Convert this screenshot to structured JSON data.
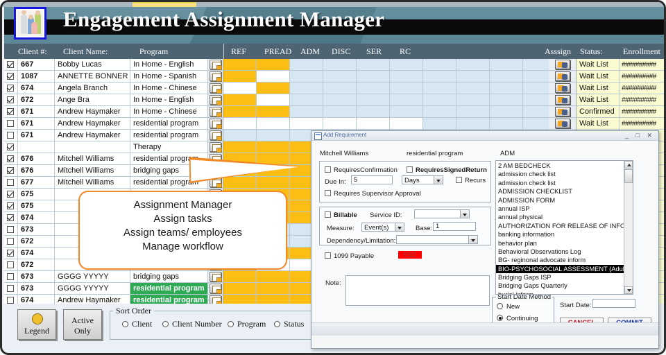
{
  "app": {
    "title": "Engagement Assignment Manager",
    "logo_alt": "people-logo"
  },
  "grid": {
    "headers_left": [
      "Client #:",
      "Client Name:",
      "Program"
    ],
    "headers_mid": [
      "REF",
      "PREAD",
      "ADM",
      "DISC",
      "SER",
      "RC"
    ],
    "assign_header": "Asssign",
    "headers_right": [
      "Status:",
      "Enrollment"
    ],
    "enrollment_mask": "##########",
    "rows": [
      {
        "checked": true,
        "num": "667",
        "name": "Bobby Lucas",
        "program": "In Home - English",
        "cells": [
          "y",
          "y",
          "b",
          "b",
          "b",
          "b",
          "b",
          "b",
          "b",
          "b",
          "b"
        ],
        "status": "Wait List",
        "green": false
      },
      {
        "checked": true,
        "num": "1087",
        "name": "ANNETTE BONNER",
        "program": "In Home - Spanish",
        "cells": [
          "y",
          "w",
          "b",
          "b",
          "b",
          "b",
          "b",
          "b",
          "b",
          "b",
          "b"
        ],
        "status": "Wait List",
        "green": false
      },
      {
        "checked": true,
        "num": "674",
        "name": "Angela Branch",
        "program": "In Home - Chinese",
        "cells": [
          "w",
          "y",
          "b",
          "b",
          "b",
          "b",
          "b",
          "b",
          "b",
          "b",
          "b"
        ],
        "status": "Wait List",
        "green": false
      },
      {
        "checked": true,
        "num": "672",
        "name": "Ange Bra",
        "program": "In Home - English",
        "cells": [
          "y",
          "w",
          "b",
          "b",
          "b",
          "b",
          "b",
          "b",
          "b",
          "b",
          "b"
        ],
        "status": "Wait List",
        "green": false
      },
      {
        "checked": true,
        "num": "671",
        "name": "Andrew Haymaker",
        "program": "In Home - Chinese",
        "cells": [
          "y",
          "y",
          "b",
          "b",
          "b",
          "b",
          "b",
          "b",
          "b",
          "b",
          "b"
        ],
        "status": "Confirmed",
        "green": false
      },
      {
        "checked": false,
        "num": "671",
        "name": "Andrew Haymaker",
        "program": "residential program",
        "cells": [
          "w",
          "w",
          "w",
          "w",
          "w",
          "w",
          "b",
          "b",
          "b",
          "b",
          "b"
        ],
        "status": "Wait List",
        "green": false
      },
      {
        "checked": false,
        "num": "671",
        "name": "Andrew Haymaker",
        "program": "residential program",
        "cells": [
          "b",
          "b",
          "b",
          "b",
          "b",
          "b",
          "b",
          "b",
          "b",
          "b",
          "b"
        ],
        "status": "",
        "green": false
      },
      {
        "checked": true,
        "num": "",
        "name": "",
        "program": "Therapy",
        "cells": [
          "y",
          "y",
          "y",
          "y",
          "y",
          "y",
          "y",
          "y",
          "y",
          "y",
          "y"
        ],
        "status": "",
        "green": false
      },
      {
        "checked": true,
        "num": "676",
        "name": "Mitchell Williams",
        "program": "residential program",
        "cells": [
          "y",
          "y",
          "y",
          "y",
          "y",
          "y",
          "y",
          "y",
          "y",
          "y",
          "y"
        ],
        "status": "",
        "green": false
      },
      {
        "checked": true,
        "num": "676",
        "name": "Mitchell Williams",
        "program": "bridging gaps",
        "cells": [
          "y",
          "y",
          "y",
          "y",
          "y",
          "y",
          "y",
          "y",
          "y",
          "y",
          "y"
        ],
        "status": "",
        "green": false
      },
      {
        "checked": false,
        "num": "677",
        "name": "Mitchell Williams",
        "program": "residential program",
        "cells": [
          "y",
          "y",
          "y",
          "y",
          "y",
          "y",
          "y",
          "y",
          "y",
          "y",
          "y"
        ],
        "status": "",
        "green": false
      },
      {
        "checked": true,
        "num": "675",
        "name": "",
        "program": "",
        "cells": [
          "y",
          "y",
          "y",
          "y",
          "y",
          "y",
          "y",
          "y",
          "y",
          "y",
          "y"
        ],
        "status": "",
        "green": false
      },
      {
        "checked": true,
        "num": "675",
        "name": "",
        "program": "",
        "cells": [
          "y",
          "y",
          "y",
          "y",
          "y",
          "y",
          "y",
          "y",
          "y",
          "y",
          "y"
        ],
        "status": "",
        "green": false
      },
      {
        "checked": true,
        "num": "674",
        "name": "",
        "program": "",
        "cells": [
          "y",
          "y",
          "y",
          "y",
          "y",
          "y",
          "y",
          "y",
          "y",
          "y",
          "y"
        ],
        "status": "",
        "green": false
      },
      {
        "checked": false,
        "num": "673",
        "name": "",
        "program": "",
        "cells": [
          "w",
          "b",
          "b",
          "b",
          "b",
          "b",
          "b",
          "b",
          "b",
          "b",
          "b"
        ],
        "status": "",
        "green": false
      },
      {
        "checked": false,
        "num": "672",
        "name": "",
        "program": "",
        "cells": [
          "w",
          "b",
          "b",
          "b",
          "b",
          "b",
          "b",
          "b",
          "b",
          "b",
          "b"
        ],
        "status": "",
        "green": false
      },
      {
        "checked": true,
        "num": "674",
        "name": "",
        "program": "",
        "cells": [
          "y",
          "y",
          "y",
          "y",
          "y",
          "y",
          "y",
          "y",
          "y",
          "y",
          "y"
        ],
        "status": "",
        "green": false
      },
      {
        "checked": false,
        "num": "672",
        "name": "",
        "program": "",
        "cells": [
          "y",
          "w",
          "w",
          "w",
          "w",
          "w",
          "w",
          "w",
          "w",
          "w",
          "w"
        ],
        "status": "",
        "green": false
      },
      {
        "checked": false,
        "num": "673",
        "name": "GGGG YYYYY",
        "program": "bridging gaps",
        "cells": [
          "y",
          "y",
          "y",
          "y",
          "y",
          "y",
          "y",
          "y",
          "y",
          "y",
          "y"
        ],
        "status": "",
        "green": false
      },
      {
        "checked": false,
        "num": "673",
        "name": "GGGG YYYYY",
        "program": "residential program",
        "cells": [
          "y",
          "y",
          "y",
          "y",
          "y",
          "y",
          "y",
          "y",
          "y",
          "y",
          "y"
        ],
        "status": "",
        "green": true
      },
      {
        "checked": false,
        "num": "674",
        "name": "Andrew Haymaker",
        "program": "residential program",
        "cells": [
          "y",
          "y",
          "y",
          "y",
          "y",
          "y",
          "y",
          "y",
          "y",
          "y",
          "y"
        ],
        "status": "",
        "green": true
      }
    ]
  },
  "callout": {
    "lines": [
      "Assignment Manager",
      "Assign tasks",
      "Assign teams/ employees",
      "Manage workflow"
    ]
  },
  "bottom": {
    "legend_label": "Legend",
    "active_only_label": "Active\nOnly",
    "active_only_line1": "Active",
    "active_only_line2": "Only",
    "sort_order_label": "Sort Order",
    "sort_options": [
      {
        "label": "Client",
        "selected": false
      },
      {
        "label": "Client Number",
        "selected": false
      },
      {
        "label": "Program",
        "selected": false
      },
      {
        "label": "Status",
        "selected": false
      },
      {
        "label": "",
        "selected": true
      }
    ]
  },
  "dialog": {
    "title": "Add Requirement",
    "window_controls": "_ □ ✕",
    "client_name": "Mitchell Williams",
    "program": "residential program",
    "phase": "ADM",
    "requires_confirmation_label": "RequiresConfirmation",
    "requires_confirmation_checked": false,
    "requires_signed_return_label": "RequiresSignedReturn",
    "requires_signed_return_checked": false,
    "due_in_label": "Due In:",
    "due_in_value": "5",
    "due_in_unit": "Days",
    "recurs_label": "Recurs",
    "recurs_checked": false,
    "supervisor_label": "Requires Supervisor Approval",
    "supervisor_checked": false,
    "billable_label": "Billable",
    "billable_checked": false,
    "service_id_label": "Service ID:",
    "service_id_value": "",
    "measure_label": "Measure:",
    "measure_value": "Event(s)",
    "base_label": "Base:",
    "base_value": "1",
    "dependency_label": "Dependency/Limitation:",
    "dependency_value": "",
    "payable_label": "1099 Payable",
    "payable_checked": false,
    "eqz_label": "EQZ",
    "note_label": "Note:",
    "note_value": "",
    "start_date_method_label": "Start Date Method",
    "start_date_methods": [
      {
        "label": "New",
        "selected": false
      },
      {
        "label": "Continuing",
        "selected": true
      }
    ],
    "start_date_label": "Start Date:",
    "start_date_value": "",
    "cancel_label": "CANCEL",
    "commit_label": "COMMIT",
    "cancel_color": "#c01020",
    "commit_color": "#1030b0",
    "requirements": [
      {
        "label": "2 AM BEDCHECK",
        "selected": false
      },
      {
        "label": "admission check list",
        "selected": false
      },
      {
        "label": "admission check list",
        "selected": false
      },
      {
        "label": "ADMISSION CHECKLIST",
        "selected": false
      },
      {
        "label": "ADMISSION FORM",
        "selected": false
      },
      {
        "label": "annual ISP",
        "selected": false
      },
      {
        "label": "annual physical",
        "selected": false
      },
      {
        "label": "AUTHORIZATION FOR RELEASE OF INFORMATION",
        "selected": false
      },
      {
        "label": "banking information",
        "selected": false
      },
      {
        "label": "behavior plan",
        "selected": false
      },
      {
        "label": "Behavioral Observations Log",
        "selected": false
      },
      {
        "label": "BG- reginonal advocate inform",
        "selected": false
      },
      {
        "label": "BIO-PSYCHOSOCIAL ASSESSMENT (Adult)",
        "selected": true
      },
      {
        "label": "Bridging Gaps ISP",
        "selected": false
      },
      {
        "label": "Bridging Gaps Quarterly",
        "selected": false
      },
      {
        "label": "burial inform",
        "selected": false
      }
    ]
  },
  "colors": {
    "banner": "#55818f",
    "header_row": "#4e6472",
    "cell_yellow": "#fcbe14",
    "cell_blue": "#d6e6f2",
    "status_bg": "#fbfbd2",
    "green": "#2eaa54",
    "callout_border": "#f08a28"
  }
}
